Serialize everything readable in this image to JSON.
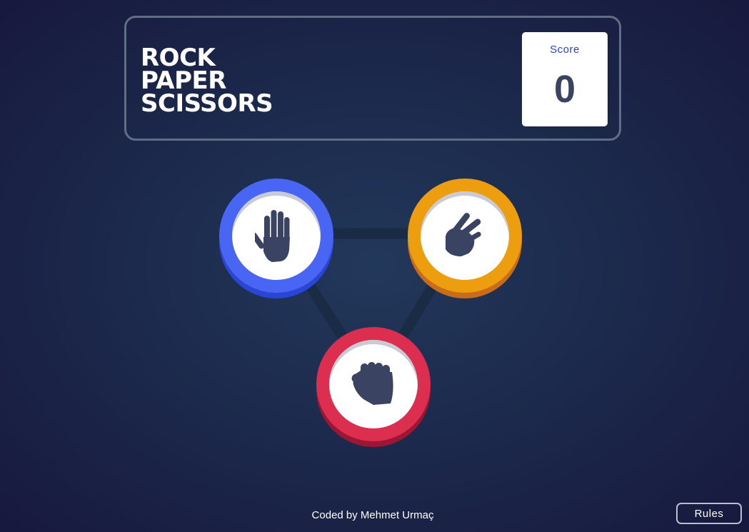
{
  "header": {
    "title_lines": [
      "ROCK",
      "PAPER",
      "SCISSORS"
    ],
    "score_label": "Score",
    "score_value": "0"
  },
  "choices": [
    {
      "id": "paper",
      "icon": "hand-paper-icon",
      "color": "#4865f4",
      "shadow": "#2b45d5"
    },
    {
      "id": "scissors",
      "icon": "hand-scissors-icon",
      "color": "#ec9e0e",
      "shadow": "#c76c1b"
    },
    {
      "id": "rock",
      "icon": "hand-rock-icon",
      "color": "#dc2e4e",
      "shadow": "#9d1634"
    }
  ],
  "footer": {
    "credit": "Coded by Mehmet Urmaç"
  },
  "rules_button": {
    "label": "Rules"
  },
  "colors": {
    "background": "#1f2b4f",
    "header_border": "#606e85",
    "icon_fill": "#3b4363"
  }
}
